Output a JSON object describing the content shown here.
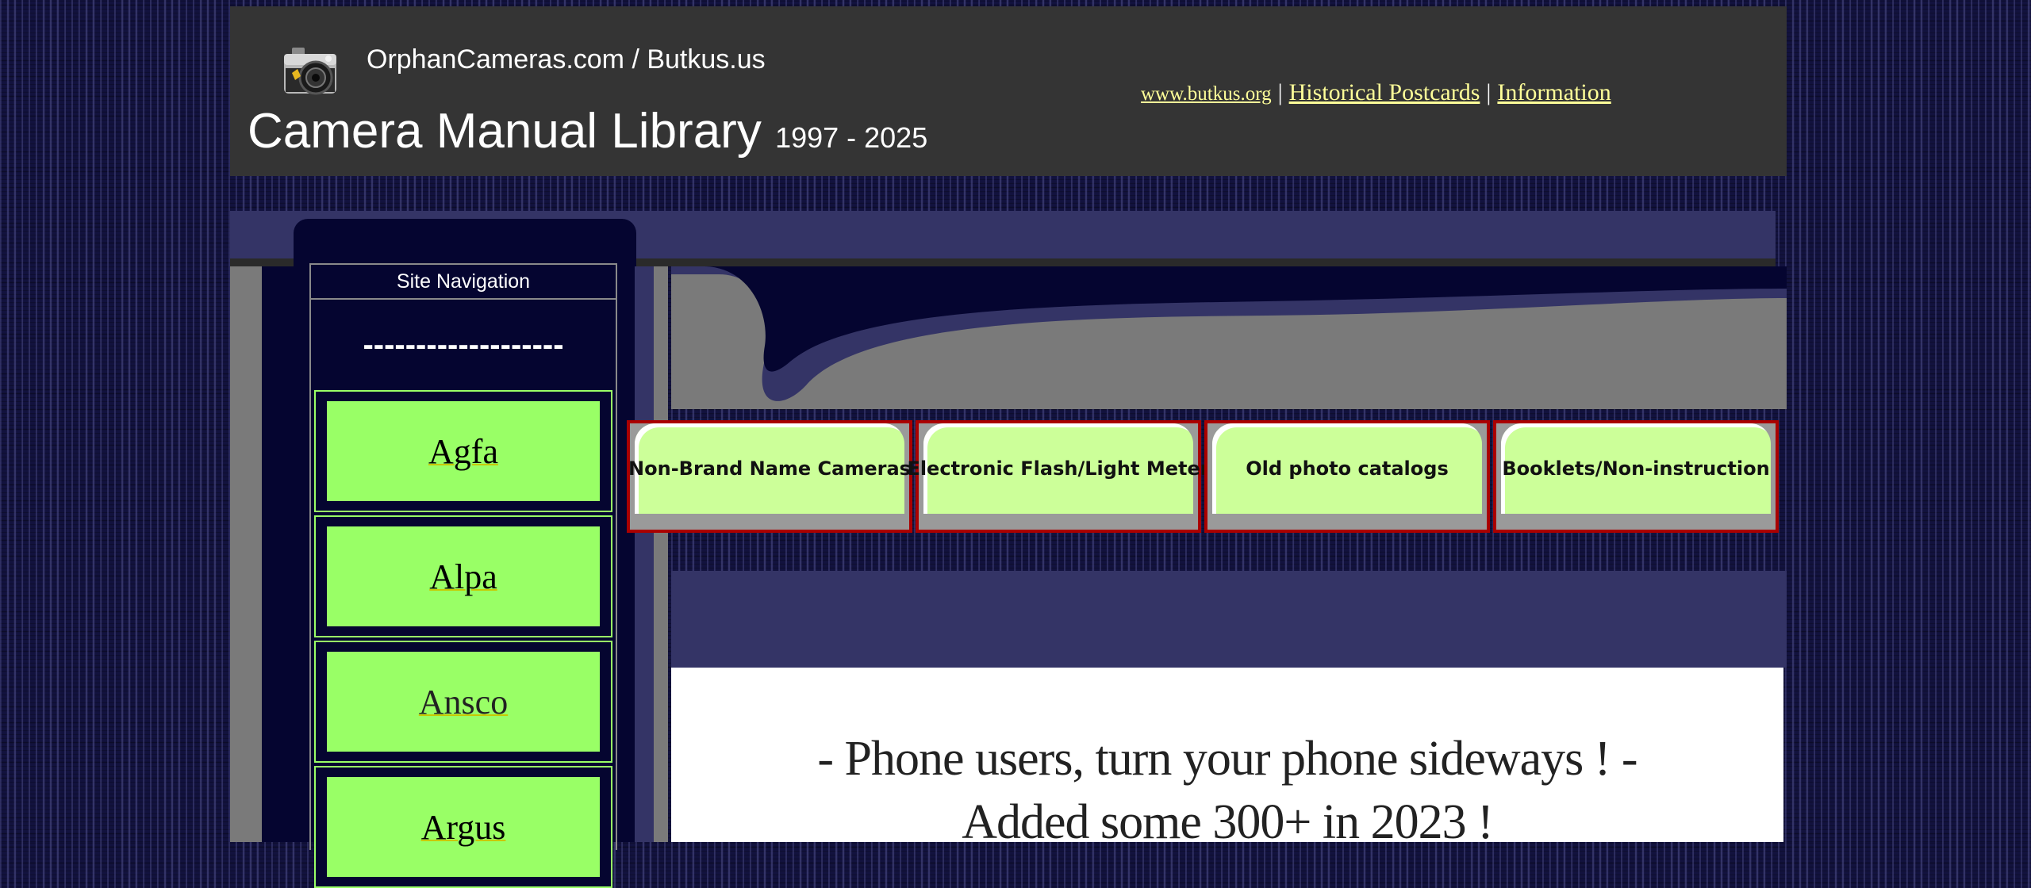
{
  "header": {
    "site_title": "OrphanCameras.com / Butkus.us",
    "main_title": "Camera Manual Library",
    "years": "1997 - 2025",
    "links": [
      "www.butkus.org",
      "Historical Postcards",
      "Information"
    ],
    "separator": "|"
  },
  "nav": {
    "header": "Site Navigation",
    "dashes": "-------------------",
    "items": [
      "Agfa",
      "Alpa",
      "Ansco",
      "Argus"
    ]
  },
  "tabs": [
    "Non-Brand Name Cameras",
    "Electronic Flash/Light Meter",
    "Old photo catalogs",
    "Booklets/Non-instruction"
  ],
  "content": {
    "line1": "- Phone users, turn your phone sideways ! -",
    "line2": "Added some 300+ in 2023 !"
  },
  "colors": {
    "page_bg": "#12123e",
    "header_bg": "#343434",
    "link": "#ffff99",
    "nav_green": "#99ff66",
    "tab_green": "#ccff99",
    "tab_border": "#aa0000",
    "purple": "#343466"
  },
  "icons": {
    "logo": "camera-icon"
  }
}
